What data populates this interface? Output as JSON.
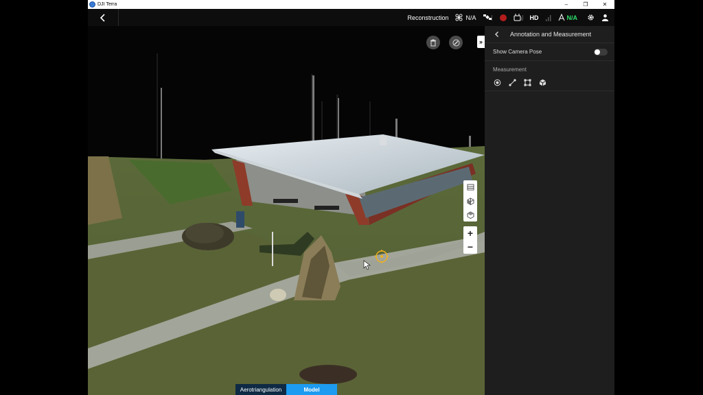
{
  "window": {
    "title": "DJI Terra",
    "minimize": "–",
    "restore": "❐",
    "close": "✕"
  },
  "topbar": {
    "mode_label": "Reconstruction",
    "rtk_status": "N/A",
    "video_quality": "HD",
    "signal_status": "N/A",
    "signal_color": "#2ee06a"
  },
  "viewport": {
    "collapse_label": "»",
    "zoom_in": "+",
    "zoom_out": "−",
    "tabs": [
      {
        "label": "Aerotriangulation",
        "active": false
      },
      {
        "label": "Model",
        "active": true
      }
    ]
  },
  "panel": {
    "title": "Annotation and Measurement",
    "show_camera_pose_label": "Show Camera Pose",
    "show_camera_pose_enabled": false,
    "measurement_label": "Measurement",
    "tools": [
      "point-measure-icon",
      "line-measure-icon",
      "area-measure-icon",
      "volume-measure-icon"
    ]
  },
  "colors": {
    "accent": "#1d9bf0",
    "panel_bg": "#1e1e1e",
    "target_marker": "#f2b21b"
  }
}
